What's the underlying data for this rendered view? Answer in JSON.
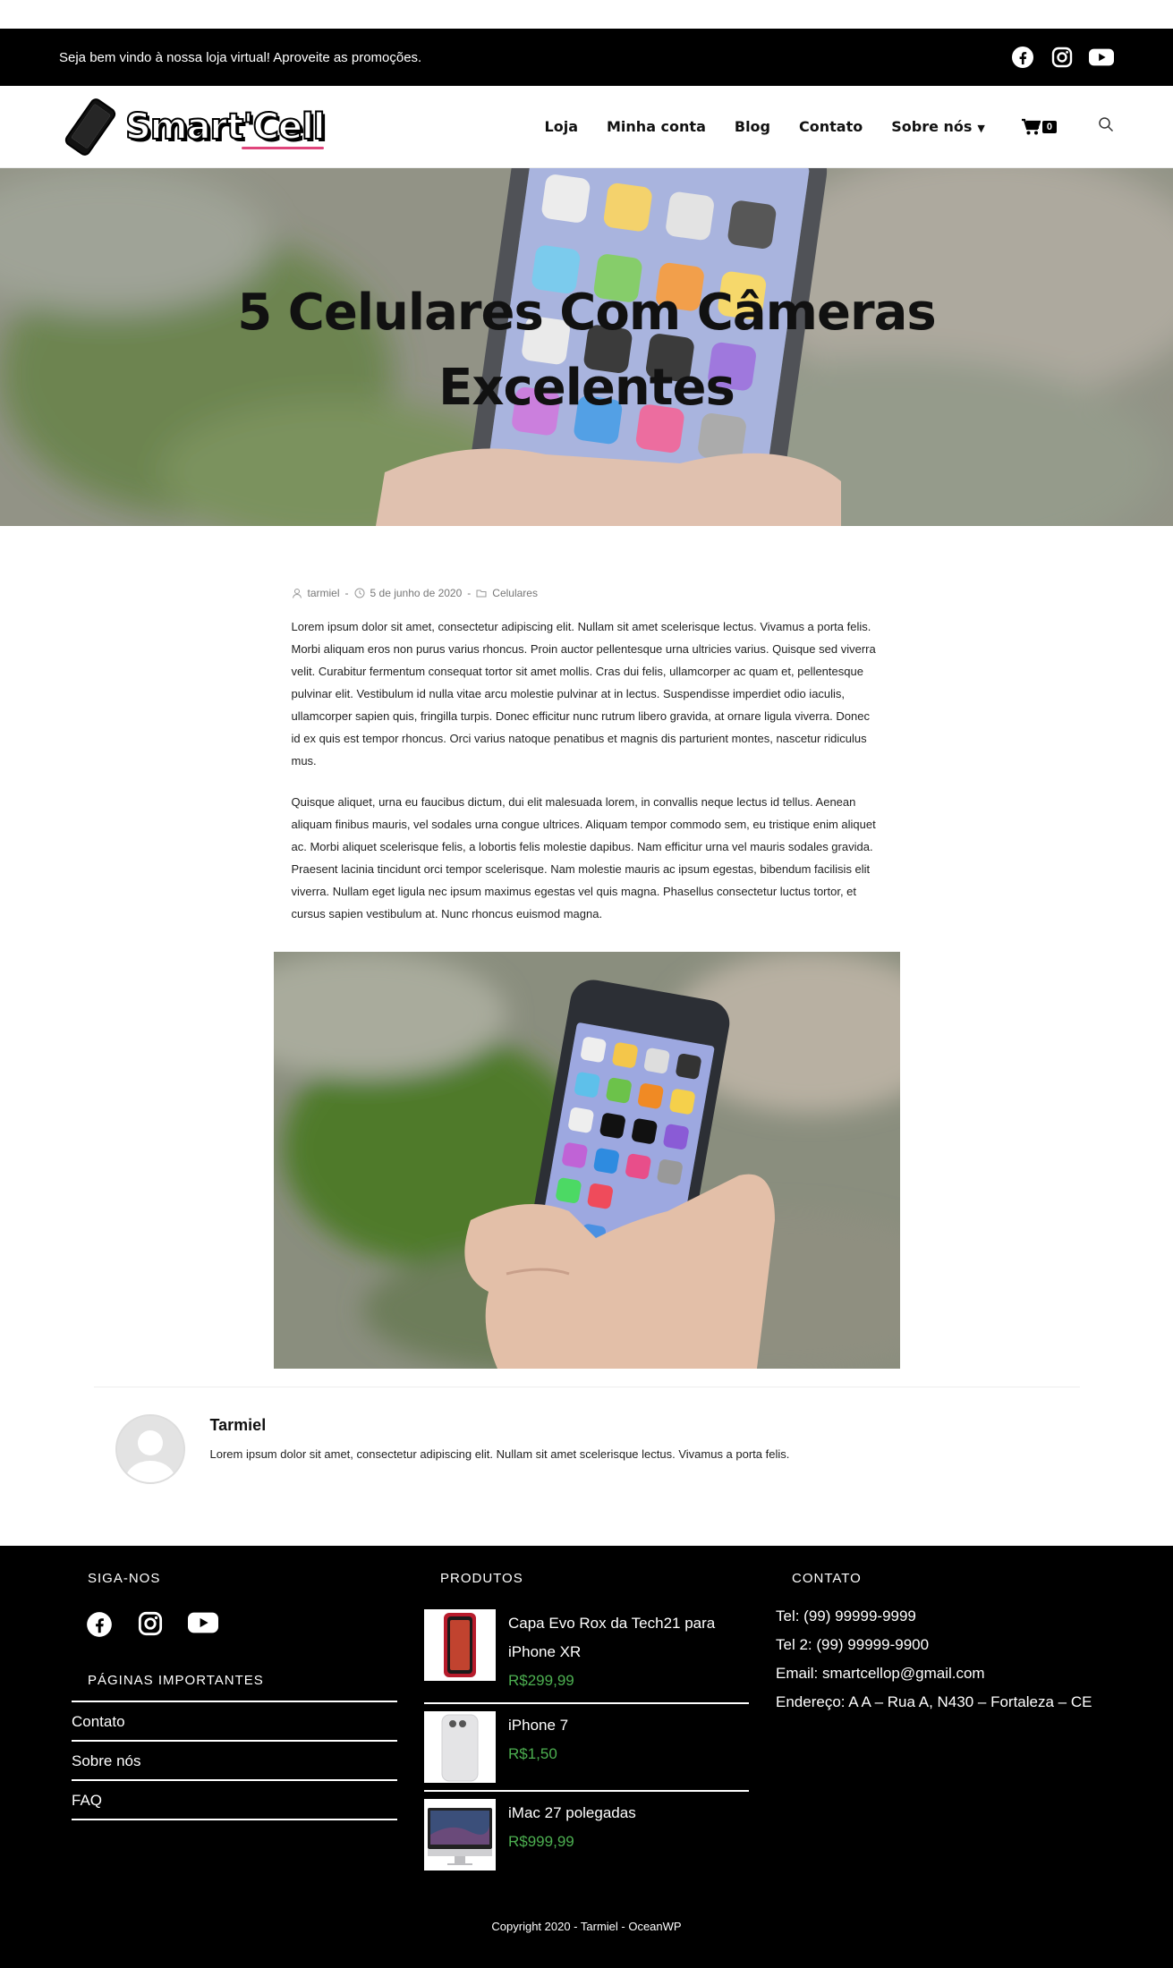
{
  "topbar": {
    "welcome": "Seja bem vindo à nossa loja virtual! Aproveite as promoções.",
    "social": [
      "facebook-icon",
      "instagram-icon",
      "youtube-icon"
    ]
  },
  "header": {
    "logo_text": "Smart'Cell",
    "nav": [
      {
        "label": "Loja"
      },
      {
        "label": "Minha conta"
      },
      {
        "label": "Blog"
      },
      {
        "label": "Contato"
      },
      {
        "label": "Sobre nós"
      }
    ],
    "cart_count": "0"
  },
  "hero": {
    "title": "5 Celulares Com Câmeras Excelentes"
  },
  "post": {
    "author": "tarmiel",
    "date": "5 de junho de 2020",
    "category": "Celulares",
    "paragraphs": [
      "Lorem ipsum dolor sit amet, consectetur adipiscing elit. Nullam sit amet scelerisque lectus. Vivamus a porta felis. Morbi aliquam eros non purus varius rhoncus. Proin auctor pellentesque urna ultricies varius. Quisque sed viverra velit. Curabitur fermentum consequat tortor sit amet mollis. Cras dui felis, ullamcorper ac quam et, pellentesque pulvinar elit. Vestibulum id nulla vitae arcu molestie pulvinar at in lectus. Suspendisse imperdiet odio iaculis, ullamcorper sapien quis, fringilla turpis. Donec efficitur nunc rutrum libero gravida, at ornare ligula viverra. Donec id ex quis est tempor rhoncus. Orci varius natoque penatibus et magnis dis parturient montes, nascetur ridiculus mus.",
      "Quisque aliquet, urna eu faucibus dictum, dui elit malesuada lorem, in convallis neque lectus id tellus. Aenean aliquam finibus mauris, vel sodales urna congue ultrices. Aliquam tempor commodo sem, eu tristique enim aliquet ac. Morbi aliquet scelerisque felis, a lobortis felis molestie dapibus. Nam efficitur urna vel mauris sodales gravida. Praesent lacinia tincidunt orci tempor scelerisque. Nam molestie mauris ac ipsum egestas, bibendum facilisis elit viverra. Nullam eget ligula nec ipsum maximus egestas vel quis magna. Phasellus consectetur luctus tortor, et cursus sapien vestibulum at. Nunc rhoncus euismod magna."
    ]
  },
  "author_box": {
    "name": "Tarmiel",
    "bio": "Lorem ipsum dolor sit amet, consectetur adipiscing elit. Nullam sit amet scelerisque lectus. Vivamus a porta felis."
  },
  "footer": {
    "follow_heading": "SIGA-NOS",
    "pages_heading": "PÁGINAS IMPORTANTES",
    "pages": [
      "Contato",
      "Sobre nós",
      "FAQ"
    ],
    "products_heading": "PRODUTOS",
    "products": [
      {
        "name_line1": "Capa Evo Rox da Tech21 para",
        "name_line2": "iPhone XR",
        "price": "R$299,99"
      },
      {
        "name_line1": "iPhone 7",
        "name_line2": "",
        "price": "R$1,50"
      },
      {
        "name_line1": "iMac 27 polegadas",
        "name_line2": "",
        "price": "R$999,99"
      }
    ],
    "contact_heading": "CONTATO",
    "contact": [
      "Tel: (99) 99999-9999",
      "Tel 2: (99) 99999-9900",
      "Email: smartcellop@gmail.com",
      "Endereço: A A – Rua A, N430 – Fortaleza – CE"
    ],
    "copyright": "Copyright 2020 - Tarmiel - OceanWP"
  },
  "colors": {
    "topbar_bg": "#000000",
    "footer_bg": "#000000",
    "price_green": "#4caf50",
    "logo_accent": "#e0457b"
  }
}
